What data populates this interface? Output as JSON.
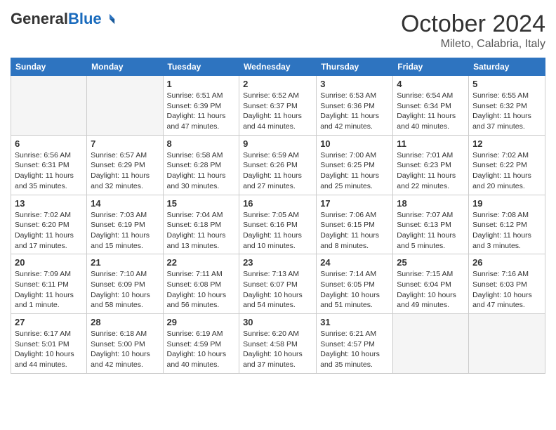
{
  "logo": {
    "general": "General",
    "blue": "Blue"
  },
  "title": "October 2024",
  "location": "Mileto, Calabria, Italy",
  "days_of_week": [
    "Sunday",
    "Monday",
    "Tuesday",
    "Wednesday",
    "Thursday",
    "Friday",
    "Saturday"
  ],
  "weeks": [
    [
      {
        "day": "",
        "info": ""
      },
      {
        "day": "",
        "info": ""
      },
      {
        "day": "1",
        "sunrise": "Sunrise: 6:51 AM",
        "sunset": "Sunset: 6:39 PM",
        "daylight": "Daylight: 11 hours and 47 minutes."
      },
      {
        "day": "2",
        "sunrise": "Sunrise: 6:52 AM",
        "sunset": "Sunset: 6:37 PM",
        "daylight": "Daylight: 11 hours and 44 minutes."
      },
      {
        "day": "3",
        "sunrise": "Sunrise: 6:53 AM",
        "sunset": "Sunset: 6:36 PM",
        "daylight": "Daylight: 11 hours and 42 minutes."
      },
      {
        "day": "4",
        "sunrise": "Sunrise: 6:54 AM",
        "sunset": "Sunset: 6:34 PM",
        "daylight": "Daylight: 11 hours and 40 minutes."
      },
      {
        "day": "5",
        "sunrise": "Sunrise: 6:55 AM",
        "sunset": "Sunset: 6:32 PM",
        "daylight": "Daylight: 11 hours and 37 minutes."
      }
    ],
    [
      {
        "day": "6",
        "sunrise": "Sunrise: 6:56 AM",
        "sunset": "Sunset: 6:31 PM",
        "daylight": "Daylight: 11 hours and 35 minutes."
      },
      {
        "day": "7",
        "sunrise": "Sunrise: 6:57 AM",
        "sunset": "Sunset: 6:29 PM",
        "daylight": "Daylight: 11 hours and 32 minutes."
      },
      {
        "day": "8",
        "sunrise": "Sunrise: 6:58 AM",
        "sunset": "Sunset: 6:28 PM",
        "daylight": "Daylight: 11 hours and 30 minutes."
      },
      {
        "day": "9",
        "sunrise": "Sunrise: 6:59 AM",
        "sunset": "Sunset: 6:26 PM",
        "daylight": "Daylight: 11 hours and 27 minutes."
      },
      {
        "day": "10",
        "sunrise": "Sunrise: 7:00 AM",
        "sunset": "Sunset: 6:25 PM",
        "daylight": "Daylight: 11 hours and 25 minutes."
      },
      {
        "day": "11",
        "sunrise": "Sunrise: 7:01 AM",
        "sunset": "Sunset: 6:23 PM",
        "daylight": "Daylight: 11 hours and 22 minutes."
      },
      {
        "day": "12",
        "sunrise": "Sunrise: 7:02 AM",
        "sunset": "Sunset: 6:22 PM",
        "daylight": "Daylight: 11 hours and 20 minutes."
      }
    ],
    [
      {
        "day": "13",
        "sunrise": "Sunrise: 7:02 AM",
        "sunset": "Sunset: 6:20 PM",
        "daylight": "Daylight: 11 hours and 17 minutes."
      },
      {
        "day": "14",
        "sunrise": "Sunrise: 7:03 AM",
        "sunset": "Sunset: 6:19 PM",
        "daylight": "Daylight: 11 hours and 15 minutes."
      },
      {
        "day": "15",
        "sunrise": "Sunrise: 7:04 AM",
        "sunset": "Sunset: 6:18 PM",
        "daylight": "Daylight: 11 hours and 13 minutes."
      },
      {
        "day": "16",
        "sunrise": "Sunrise: 7:05 AM",
        "sunset": "Sunset: 6:16 PM",
        "daylight": "Daylight: 11 hours and 10 minutes."
      },
      {
        "day": "17",
        "sunrise": "Sunrise: 7:06 AM",
        "sunset": "Sunset: 6:15 PM",
        "daylight": "Daylight: 11 hours and 8 minutes."
      },
      {
        "day": "18",
        "sunrise": "Sunrise: 7:07 AM",
        "sunset": "Sunset: 6:13 PM",
        "daylight": "Daylight: 11 hours and 5 minutes."
      },
      {
        "day": "19",
        "sunrise": "Sunrise: 7:08 AM",
        "sunset": "Sunset: 6:12 PM",
        "daylight": "Daylight: 11 hours and 3 minutes."
      }
    ],
    [
      {
        "day": "20",
        "sunrise": "Sunrise: 7:09 AM",
        "sunset": "Sunset: 6:11 PM",
        "daylight": "Daylight: 11 hours and 1 minute."
      },
      {
        "day": "21",
        "sunrise": "Sunrise: 7:10 AM",
        "sunset": "Sunset: 6:09 PM",
        "daylight": "Daylight: 10 hours and 58 minutes."
      },
      {
        "day": "22",
        "sunrise": "Sunrise: 7:11 AM",
        "sunset": "Sunset: 6:08 PM",
        "daylight": "Daylight: 10 hours and 56 minutes."
      },
      {
        "day": "23",
        "sunrise": "Sunrise: 7:13 AM",
        "sunset": "Sunset: 6:07 PM",
        "daylight": "Daylight: 10 hours and 54 minutes."
      },
      {
        "day": "24",
        "sunrise": "Sunrise: 7:14 AM",
        "sunset": "Sunset: 6:05 PM",
        "daylight": "Daylight: 10 hours and 51 minutes."
      },
      {
        "day": "25",
        "sunrise": "Sunrise: 7:15 AM",
        "sunset": "Sunset: 6:04 PM",
        "daylight": "Daylight: 10 hours and 49 minutes."
      },
      {
        "day": "26",
        "sunrise": "Sunrise: 7:16 AM",
        "sunset": "Sunset: 6:03 PM",
        "daylight": "Daylight: 10 hours and 47 minutes."
      }
    ],
    [
      {
        "day": "27",
        "sunrise": "Sunrise: 6:17 AM",
        "sunset": "Sunset: 5:01 PM",
        "daylight": "Daylight: 10 hours and 44 minutes."
      },
      {
        "day": "28",
        "sunrise": "Sunrise: 6:18 AM",
        "sunset": "Sunset: 5:00 PM",
        "daylight": "Daylight: 10 hours and 42 minutes."
      },
      {
        "day": "29",
        "sunrise": "Sunrise: 6:19 AM",
        "sunset": "Sunset: 4:59 PM",
        "daylight": "Daylight: 10 hours and 40 minutes."
      },
      {
        "day": "30",
        "sunrise": "Sunrise: 6:20 AM",
        "sunset": "Sunset: 4:58 PM",
        "daylight": "Daylight: 10 hours and 37 minutes."
      },
      {
        "day": "31",
        "sunrise": "Sunrise: 6:21 AM",
        "sunset": "Sunset: 4:57 PM",
        "daylight": "Daylight: 10 hours and 35 minutes."
      },
      {
        "day": "",
        "info": ""
      },
      {
        "day": "",
        "info": ""
      }
    ]
  ]
}
